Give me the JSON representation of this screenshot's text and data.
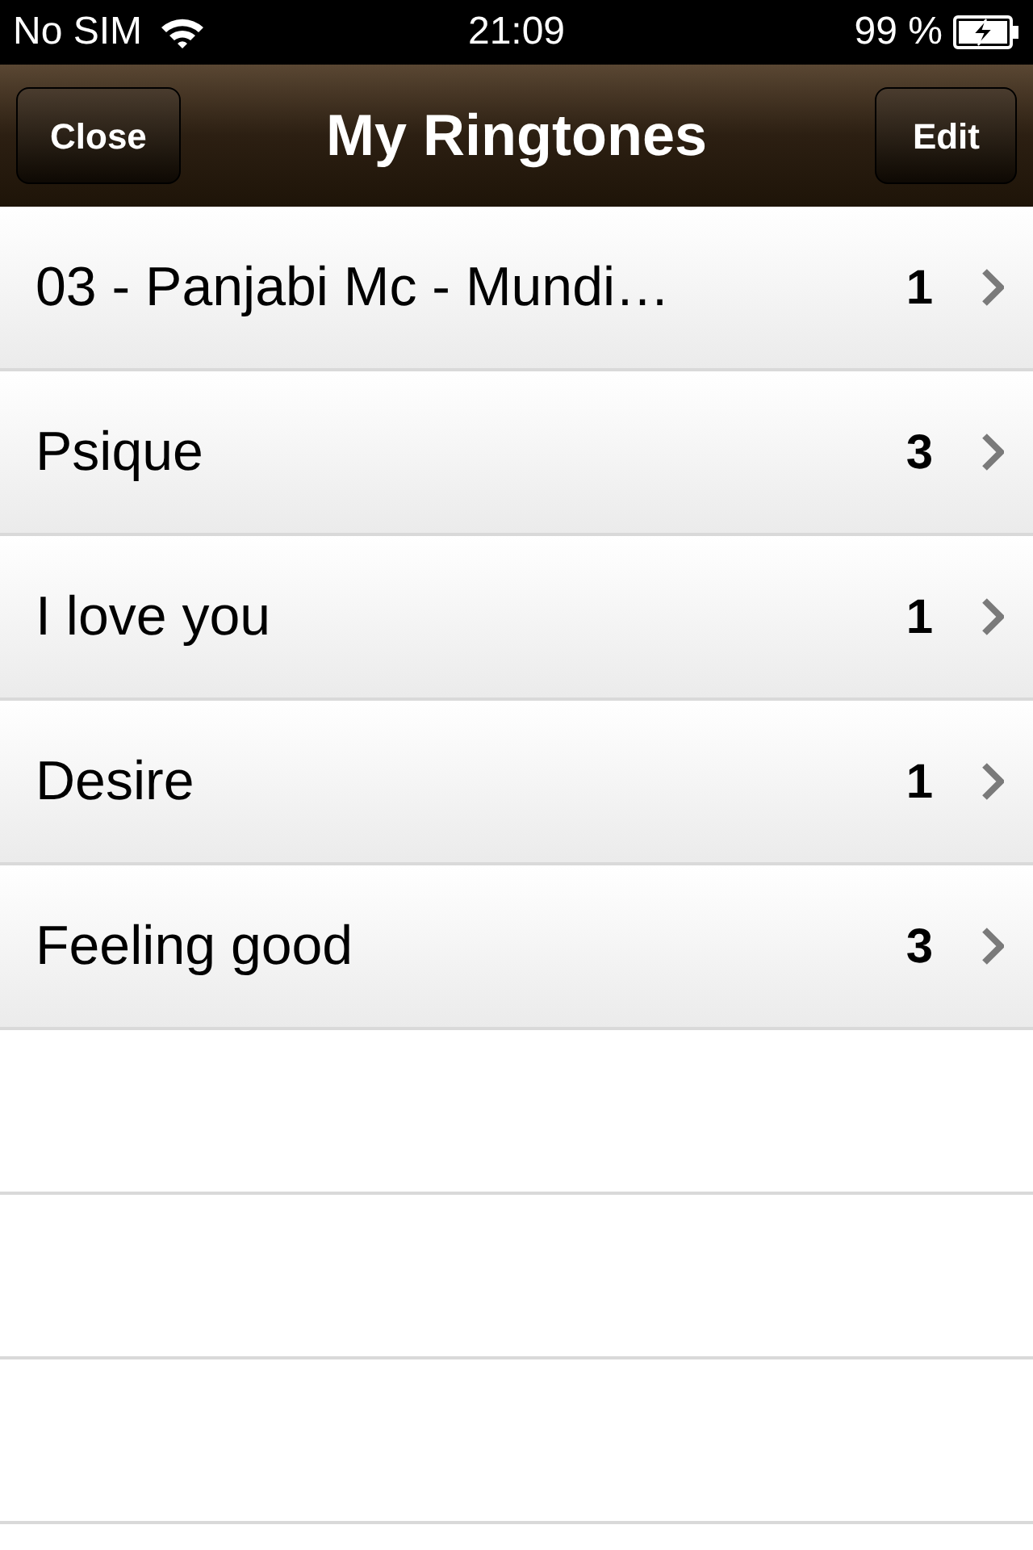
{
  "status_bar": {
    "carrier": "No SIM",
    "time": "21:09",
    "battery": "99 %"
  },
  "nav_bar": {
    "left_button": "Close",
    "title": "My Ringtones",
    "right_button": "Edit"
  },
  "rows": [
    {
      "title": "03 - Panjabi Mc - Mundi…",
      "count": "1"
    },
    {
      "title": "Psique",
      "count": "3"
    },
    {
      "title": "I love you",
      "count": "1"
    },
    {
      "title": "Desire",
      "count": "1"
    },
    {
      "title": "Feeling good",
      "count": "3"
    }
  ]
}
